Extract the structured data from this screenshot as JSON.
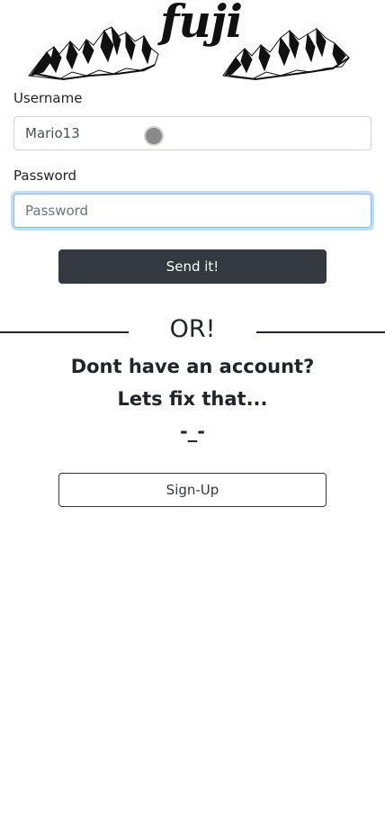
{
  "logo": {
    "text": "fuji",
    "icon": "mountain-range-icon"
  },
  "form": {
    "username_label": "Username",
    "username_value": "Mario13",
    "password_label": "Password",
    "password_placeholder": "Password",
    "submit_label": "Send it!"
  },
  "alt": {
    "or_text": "OR!",
    "line1": "Dont have an account?",
    "line2": "Lets fix that...",
    "line3": "-_-",
    "signup_label": "Sign-Up"
  },
  "colors": {
    "dark_button": "#343a40",
    "focus_border": "#80bdff",
    "text": "#212529"
  }
}
